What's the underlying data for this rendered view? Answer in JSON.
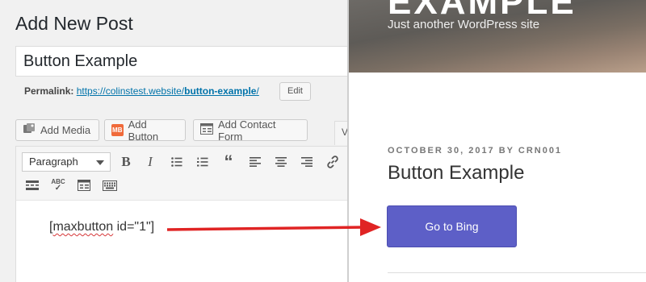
{
  "editor": {
    "page_title": "Add New Post",
    "post_title": "Button Example",
    "permalink": {
      "label": "Permalink:",
      "base": "https://colinstest.website/",
      "slug": "button-example",
      "trailing": "/",
      "edit_label": "Edit"
    },
    "media_buttons": [
      {
        "label": "Add Media",
        "icon": "media-icon"
      },
      {
        "label": "Add Button",
        "icon": "maxbuttons-icon",
        "badge": "MB"
      },
      {
        "label": "Add Contact Form",
        "icon": "form-icon"
      }
    ],
    "tab_hint": "V",
    "toolbar": {
      "format": "Paragraph",
      "row1": [
        "bold-icon",
        "italic-icon",
        "bullet-list-icon",
        "numbered-list-icon",
        "blockquote-icon",
        "align-left-icon",
        "align-center-icon",
        "align-right-icon",
        "link-icon"
      ],
      "row2": [
        "read-more-icon",
        "spellcheck-icon",
        "form-icon",
        "keyboard-icon"
      ]
    },
    "content": {
      "prefix": "[",
      "misspelled": "maxbutton",
      "suffix": " id=\"1\"]"
    }
  },
  "preview": {
    "site_name": "EXAMPLE",
    "tagline": "Just another WordPress site",
    "meta": "OCTOBER 30, 2017 BY CRN001",
    "post_title": "Button Example",
    "button_label": "Go to Bing"
  },
  "colors": {
    "link": "#0073aa",
    "button": "#5d5fc7",
    "arrow": "#e02424"
  }
}
